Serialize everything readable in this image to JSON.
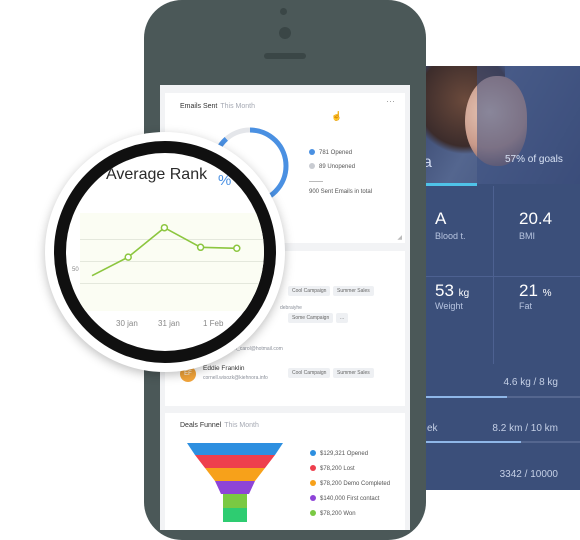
{
  "health": {
    "goal_text": "57% of goals",
    "big_letter": "a",
    "metrics": [
      {
        "value": "A",
        "unit": "",
        "label": "Blood t."
      },
      {
        "value": "20.4",
        "unit": "",
        "label": "BMI"
      },
      {
        "value": "53",
        "unit": "kg",
        "label": "Weight"
      },
      {
        "value": "21",
        "unit": "%",
        "label": "Fat"
      }
    ],
    "progress": [
      {
        "left": "",
        "right": "4.6 kg / 8 kg",
        "fraction": 0.58
      },
      {
        "left": "ek",
        "right": "8.2 km / 10 km",
        "fraction": 0.66
      },
      {
        "left": "",
        "right": "3342 / 10000",
        "fraction": 0.33
      }
    ]
  },
  "emails_card": {
    "title": "Emails Sent",
    "period": "This Month",
    "more_icon": "ellipsis-icon",
    "legend": [
      {
        "text": "781 Opened",
        "color": "#4a90e2"
      },
      {
        "text": "89 Unopened",
        "color": "#c9ccd2"
      }
    ],
    "total": "900 Sent Emails in total",
    "donut_percent_text": "%"
  },
  "contacts_card": {
    "tags_row1": [
      "Cool Campaign",
      "Summer Sales"
    ],
    "tags_row2": [
      "Some Campaign",
      "..."
    ],
    "tags_row3": [
      "Cool Campaign",
      "Summer Sales"
    ],
    "partial_mail_1": "debraiyhe",
    "partial_mail_2": "ppon_carol@hotmail.com",
    "partial_name_2": "ys",
    "contact": {
      "initials": "EF",
      "name": "Eddie Franklin",
      "email": "cornell.wisozk@kiehnora.info"
    }
  },
  "funnel_card": {
    "title": "Deals Funnel",
    "period": "This Month",
    "stages": [
      {
        "text": "$129,321 Opened",
        "color": "#2d8fe0"
      },
      {
        "text": "$78,200 Lost",
        "color": "#ee3f4d"
      },
      {
        "text": "$78,200 Demo Completed",
        "color": "#f7a11a"
      },
      {
        "text": "$140,000 First contact",
        "color": "#8e44d8"
      },
      {
        "text": "$78,200 Won",
        "color": "#7ac943"
      }
    ]
  },
  "magnifier": {
    "title": "Average Rank",
    "ytick": "50",
    "chart_data": {
      "type": "line",
      "title": "Average Rank",
      "x": [
        "30 jan",
        "31 jan",
        "1 Feb"
      ],
      "xlabels_visible": [
        "30 jan",
        "31 jan",
        "1 Feb"
      ],
      "series": [
        {
          "values": [
            36,
            55,
            85,
            65,
            64
          ]
        }
      ],
      "ylim": [
        0,
        100
      ],
      "color": "#8cc63f"
    }
  },
  "colors": {
    "phone": "#4b5858",
    "panel": "#3b4f7a",
    "accent": "#4fc3e8"
  }
}
